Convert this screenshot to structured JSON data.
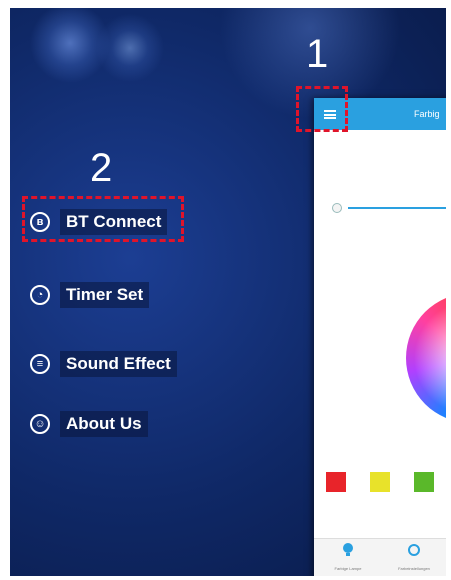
{
  "annotations": {
    "step1": "1",
    "step2": "2"
  },
  "menu": {
    "items": [
      {
        "label": "BT Connect",
        "icon": "bluetooth-icon"
      },
      {
        "label": "Timer Set",
        "icon": "clock-icon"
      },
      {
        "label": "Sound Effect",
        "icon": "equalizer-icon"
      },
      {
        "label": "About Us",
        "icon": "person-icon"
      }
    ]
  },
  "phone": {
    "title": "Farbig",
    "accent": "#2aa0e0",
    "swatches": [
      "#e8242a",
      "#e8e22a",
      "#5ab82a"
    ],
    "bottom_tabs": [
      {
        "icon": "bulb-icon",
        "label": "Farbige Lampe"
      },
      {
        "icon": "music-icon",
        "label": "Farbeinstellungen"
      }
    ]
  },
  "highlight_color": "#e0142a"
}
